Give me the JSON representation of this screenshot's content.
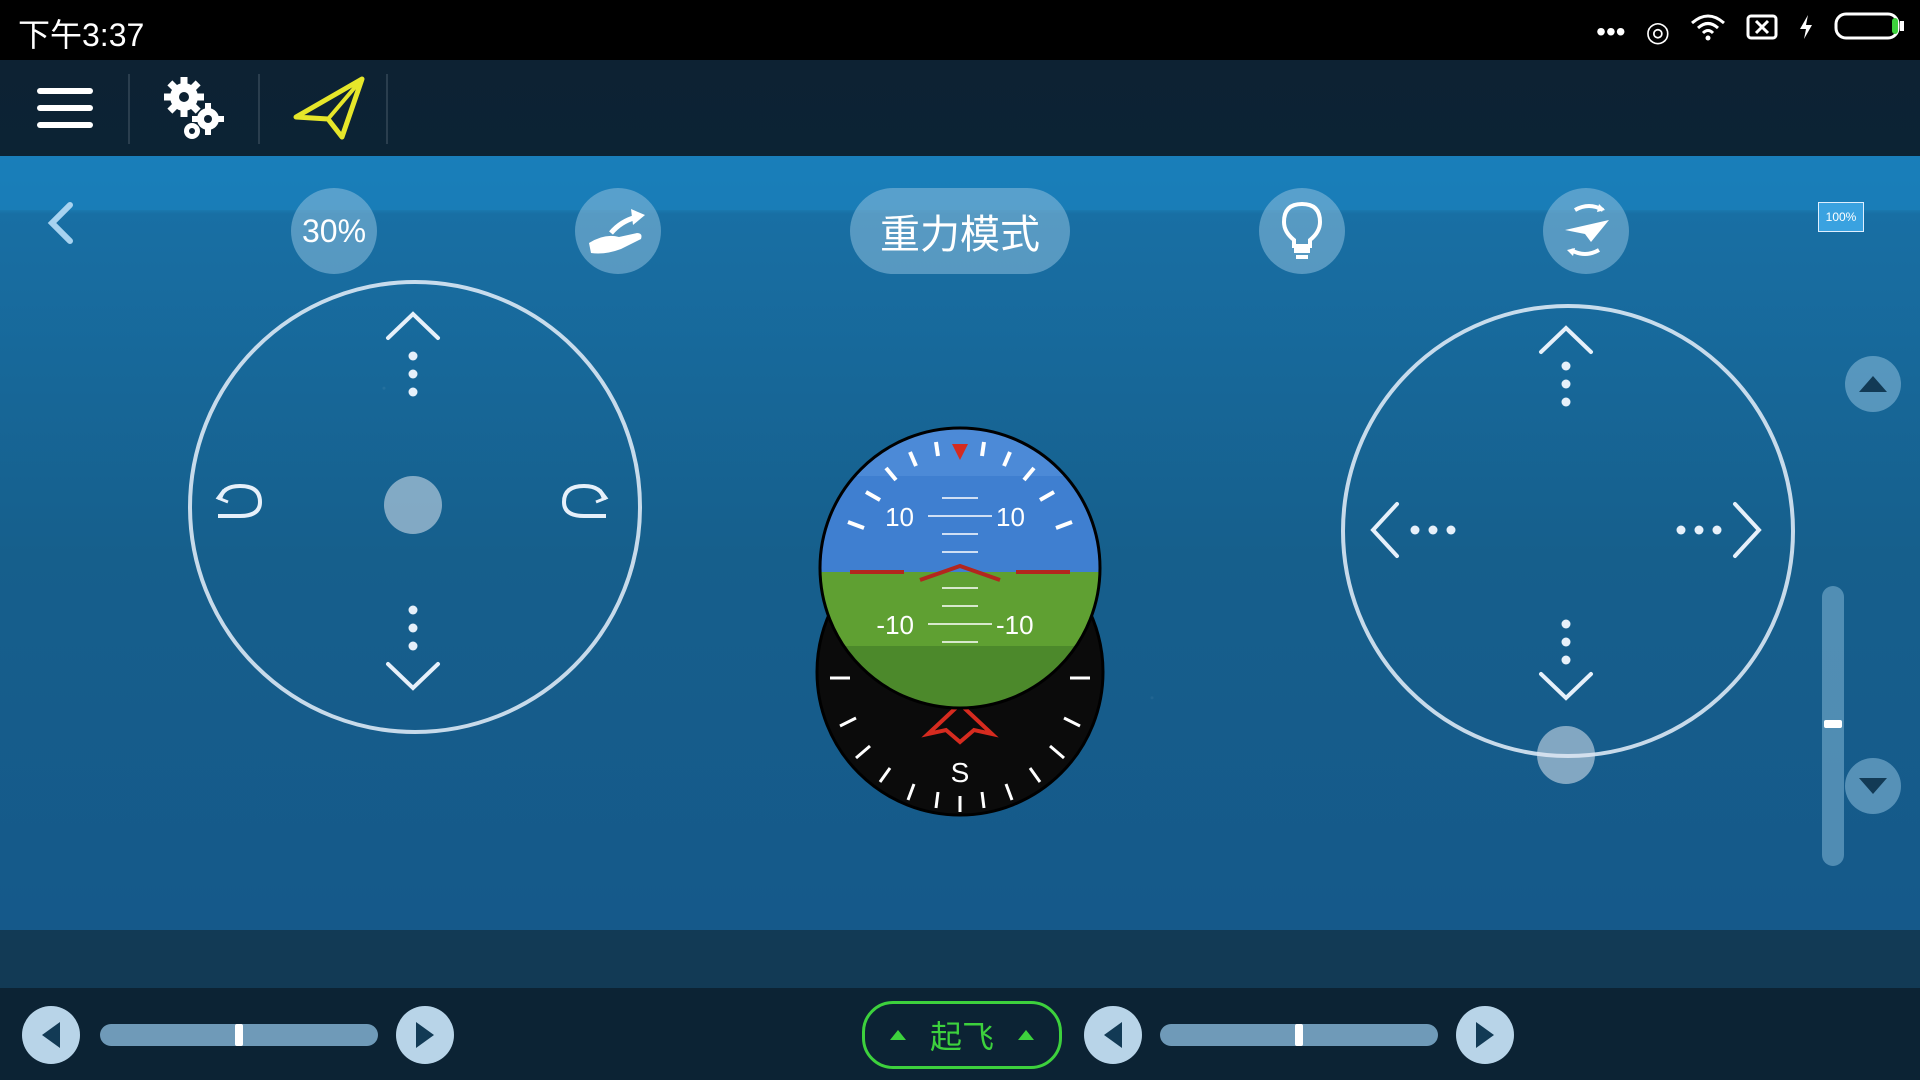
{
  "status_bar": {
    "time": "下午3:37"
  },
  "toolbar": {
    "menu_icon": "menu-icon",
    "settings_icon": "settings-icon",
    "mode_icon": "paper-plane-icon"
  },
  "controls": {
    "speed": "30%",
    "mode": "重力模式",
    "battery": "100%"
  },
  "bottom": {
    "takeoff_label": "起飞",
    "left_slider_level": 0.5,
    "right_slider_level": 0.5
  },
  "attitude": {
    "pitch_labels_top": [
      "10",
      "10"
    ],
    "pitch_labels_bottom": [
      "-10",
      "-10"
    ],
    "heading_label": "S"
  },
  "colors": {
    "sky": "#3f7fd0",
    "ground": "#5fa032",
    "accent_green": "#3dd13d",
    "heading_red": "#d62b1f"
  }
}
